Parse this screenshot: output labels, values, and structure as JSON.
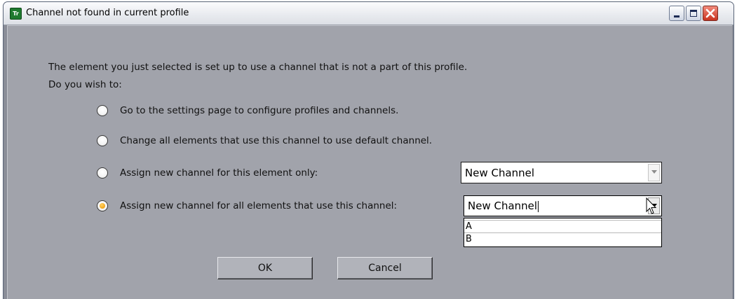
{
  "window": {
    "title": "Channel not found in current profile",
    "app_icon_text": "Tr"
  },
  "dialog": {
    "message_line1": "The element you just selected is set up to use a channel that is not a part of this profile.",
    "message_line2": "Do you wish to:",
    "options": [
      {
        "label": "Go to the settings page to configure profiles and channels.",
        "selected": false
      },
      {
        "label": "Change all elements that use this channel to use default channel.",
        "selected": false
      },
      {
        "label": "Assign new channel for this element only:",
        "selected": false
      },
      {
        "label": "Assign new channel for all elements that use this channel:",
        "selected": true
      }
    ],
    "combo_element_only": {
      "value": "New Channel",
      "enabled": false
    },
    "combo_all_elements": {
      "value": "New Channel",
      "enabled": true,
      "open": true
    },
    "dropdown_options": [
      "A",
      "B"
    ],
    "ok_label": "OK",
    "cancel_label": "Cancel"
  },
  "icons": {
    "app": "app-icon",
    "minimize": "minimize-icon",
    "maximize": "maximize-icon",
    "close": "close-icon",
    "cursor": "mouse-pointer-icon"
  },
  "colors": {
    "dialog_background": "#a1a3ab",
    "selected_radio": "#f2a516",
    "close_button": "#c8331f"
  }
}
